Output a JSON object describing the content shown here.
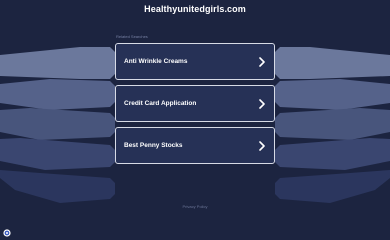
{
  "header": {
    "domain": "Healthyunitedgirls.com"
  },
  "related_searches": {
    "label": "Related Searches",
    "items": [
      {
        "label": "Anti Wrinkle Creams",
        "icon": "chevron-right-icon"
      },
      {
        "label": "Credit Card Application",
        "icon": "chevron-right-icon"
      },
      {
        "label": "Best Penny Stocks",
        "icon": "chevron-right-icon"
      }
    ]
  },
  "footer": {
    "privacy_label": "Privacy Policy"
  },
  "corner": {
    "icon": "info-badge-icon"
  },
  "colors": {
    "background": "#1c2440",
    "card": "#263156",
    "card_border": "#d7dbe6",
    "side_shape_light": "#6d7a9e",
    "side_shape_dark": "#27315a",
    "text": "#ffffff"
  }
}
